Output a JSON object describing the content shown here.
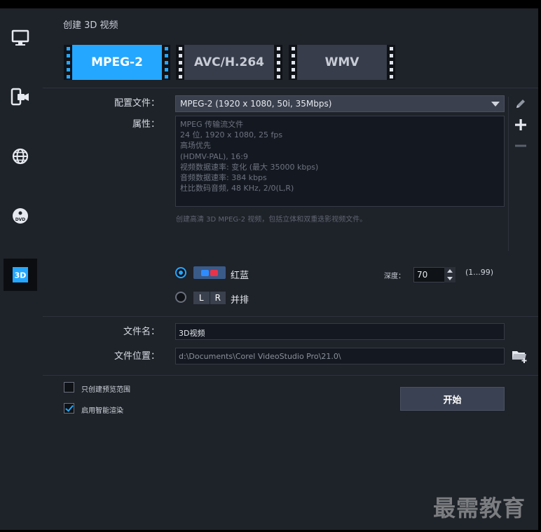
{
  "sidebar": {
    "items": [
      {
        "icon": "monitor-icon",
        "active": false
      },
      {
        "icon": "mobile-device-icon",
        "active": false
      },
      {
        "icon": "globe-icon",
        "active": false
      },
      {
        "icon": "dvd-icon",
        "icon_text": "DVD",
        "active": false
      },
      {
        "icon": "3d-icon",
        "icon_text": "3D",
        "active": true
      }
    ]
  },
  "header": {
    "title": "创建 3D 视频"
  },
  "tabs": [
    {
      "label": "MPEG-2",
      "active": true
    },
    {
      "label": "AVC/H.264",
      "active": false
    },
    {
      "label": "WMV",
      "active": false
    }
  ],
  "profile": {
    "label": "配置文件：",
    "value": "MPEG-2 (1920 x 1080, 50i, 35Mbps)"
  },
  "properties": {
    "label": "属性：",
    "lines": [
      "MPEG 传输流文件",
      "24 位, 1920 x 1080, 25 fps",
      "高场优先",
      "(HDMV-PAL),  16:9",
      "视频数据速率: 变化 (最大 35000 kbps)",
      "音频数据速率: 384 kbps",
      "杜比数码音频, 48 KHz, 2/0(L,R)"
    ]
  },
  "description": "创建高清 3D MPEG-2 视频，包括立体和双重迭影视频文件。",
  "stereo_options": {
    "anaglyph": {
      "label": "红蓝",
      "checked": true
    },
    "side_by_side": {
      "label": "并排",
      "checked": false,
      "left": "L",
      "right": "R"
    }
  },
  "depth": {
    "label": "深度：",
    "value": "70",
    "range": "(1...99)"
  },
  "filename": {
    "label": "文件名：",
    "value": "3D视频"
  },
  "location": {
    "label": "文件位置：",
    "value": "d:\\Documents\\Corel VideoStudio Pro\\21.0\\"
  },
  "checkboxes": [
    {
      "label": "只创建预览范围",
      "checked": false
    },
    {
      "label": "启用智能渲染",
      "checked": true
    }
  ],
  "start_button": {
    "label": "开始"
  },
  "watermark": "最需教育",
  "colors": {
    "accent": "#24a7ff",
    "panel": "#1e2229",
    "tab_inactive": "#373d4a",
    "anaglyph_red": "#e8334a",
    "anaglyph_blue": "#2f8cff"
  }
}
